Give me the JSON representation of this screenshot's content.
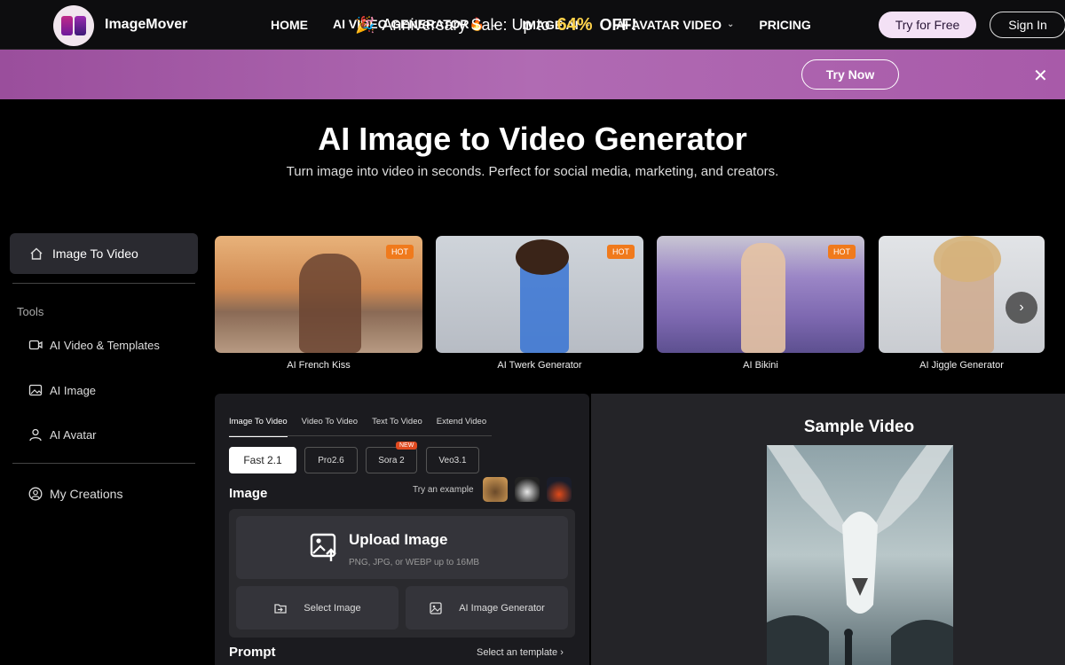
{
  "brand": {
    "name": "ImageMover"
  },
  "nav": {
    "items": [
      {
        "label": "HOME",
        "has_chevron": false
      },
      {
        "label": "AI VIDEO GENERATOR🔥",
        "has_chevron": true
      },
      {
        "label": "IMAGE AI",
        "has_chevron": true
      },
      {
        "label": "AI AVATAR VIDEO",
        "has_chevron": true
      },
      {
        "label": "PRICING",
        "has_chevron": false
      }
    ],
    "try_free": "Try for Free",
    "sign_in": "Sign In"
  },
  "banner": {
    "text": "Anniversary Sale: Up to",
    "percent": "64%",
    "suffix": "OFF!",
    "cta": "Try Now",
    "accent_color": "#ffd24a"
  },
  "hero": {
    "title": "AI Image to Video Generator",
    "subtitle": "Turn image into video in seconds. Perfect for social media, marketing, and creators."
  },
  "sidebar": {
    "active": "Image To Video",
    "tools_heading": "Tools",
    "tools": [
      "AI Video & Templates",
      "AI Image",
      "AI Avatar"
    ],
    "creations": "My Creations"
  },
  "cards": [
    {
      "label": "AI French Kiss",
      "badge": "HOT"
    },
    {
      "label": "AI Twerk Generator",
      "badge": "HOT"
    },
    {
      "label": "AI Bikini",
      "badge": "HOT"
    },
    {
      "label": "AI Jiggle Generator",
      "badge": ""
    }
  ],
  "panel": {
    "tabs": [
      "Image To Video",
      "Video To Video",
      "Text To Video",
      "Extend Video"
    ],
    "models": [
      "Fast 2.1",
      "Pro2.6",
      "Sora 2",
      "Veo3.1"
    ],
    "new_badge": "NEW",
    "image_label": "Image",
    "try_example": "Try an example",
    "upload_title": "Upload Image",
    "upload_sub": "PNG, JPG, or WEBP up to 16MB",
    "select_image": "Select Image",
    "ai_image_generator": "AI Image Generator",
    "prompt_label": "Prompt",
    "select_template": "Select an template"
  },
  "sample": {
    "title": "Sample Video"
  }
}
